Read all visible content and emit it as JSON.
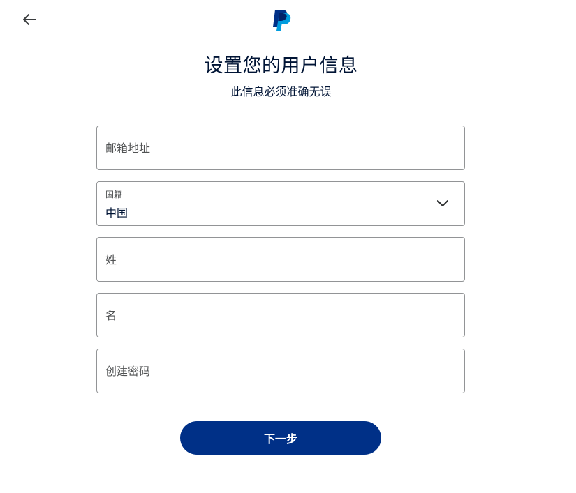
{
  "header": {
    "back_icon": "arrow-left-icon",
    "logo_icon": "paypal-logo-icon",
    "brand_colors": {
      "dark_blue": "#003087",
      "light_blue": "#009cde",
      "mid_blue": "#012169"
    }
  },
  "main": {
    "title": "设置您的用户信息",
    "subtitle": "此信息必须准确无误"
  },
  "form": {
    "email": {
      "placeholder": "邮箱地址",
      "value": ""
    },
    "nationality": {
      "label": "国籍",
      "value": "中国",
      "icon": "chevron-down-icon"
    },
    "last_name": {
      "placeholder": "姓",
      "value": ""
    },
    "first_name": {
      "placeholder": "名",
      "value": ""
    },
    "password": {
      "placeholder": "创建密码",
      "value": ""
    }
  },
  "actions": {
    "next_label": "下一步",
    "next_color": "#003087"
  }
}
